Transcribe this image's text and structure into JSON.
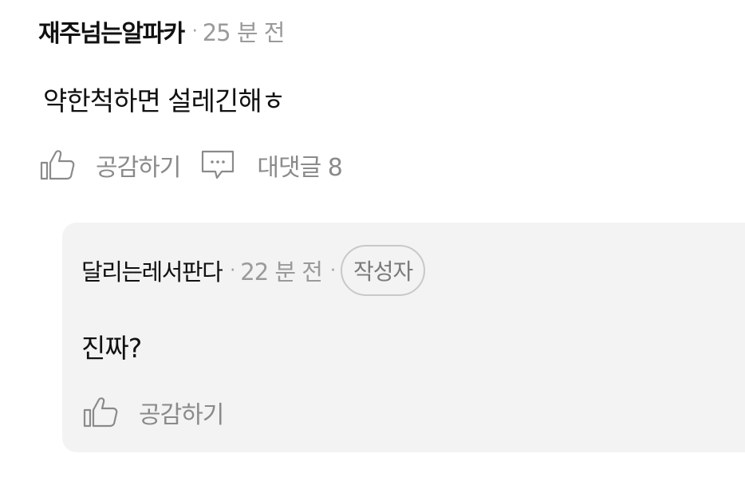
{
  "comment": {
    "author": "재주넘는알파카",
    "separator": "·",
    "time": "25 분 전",
    "text": "약한척하면 설레긴해ㅎ",
    "like_label": "공감하기",
    "reply_label": "대댓글 8",
    "like_icon": "thumbs-up-icon",
    "reply_icon": "speech-bubble-icon"
  },
  "reply": {
    "author": "달리는레서판다",
    "separator": "·",
    "time": "22 분 전",
    "separator2": "·",
    "badge": "작성자",
    "text": "진짜?",
    "like_label": "공감하기",
    "like_icon": "thumbs-up-icon"
  },
  "colors": {
    "text_primary": "#111111",
    "text_muted": "#9a9a9a",
    "reply_background": "#f3f3f3",
    "badge_border": "#c8c8c8"
  }
}
